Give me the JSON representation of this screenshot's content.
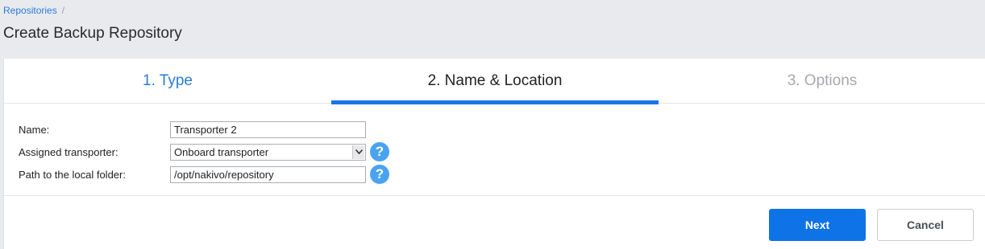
{
  "breadcrumb": {
    "link": "Repositories",
    "separator": "/"
  },
  "page": {
    "title": "Create Backup Repository"
  },
  "wizard": {
    "steps": [
      {
        "label": "1. Type",
        "state": "completed"
      },
      {
        "label": "2. Name & Location",
        "state": "active"
      },
      {
        "label": "3. Options",
        "state": "pending"
      }
    ]
  },
  "form": {
    "name": {
      "label": "Name:",
      "value": "Transporter 2"
    },
    "transporter": {
      "label": "Assigned transporter:",
      "value": "Onboard transporter"
    },
    "path": {
      "label": "Path to the local folder:",
      "value": "/opt/nakivo/repository"
    },
    "help_glyph": "?"
  },
  "actions": {
    "next": "Next",
    "cancel": "Cancel"
  },
  "colors": {
    "accent": "#1a73e8",
    "help": "#4aa3f0",
    "link": "#2b7bd6"
  }
}
